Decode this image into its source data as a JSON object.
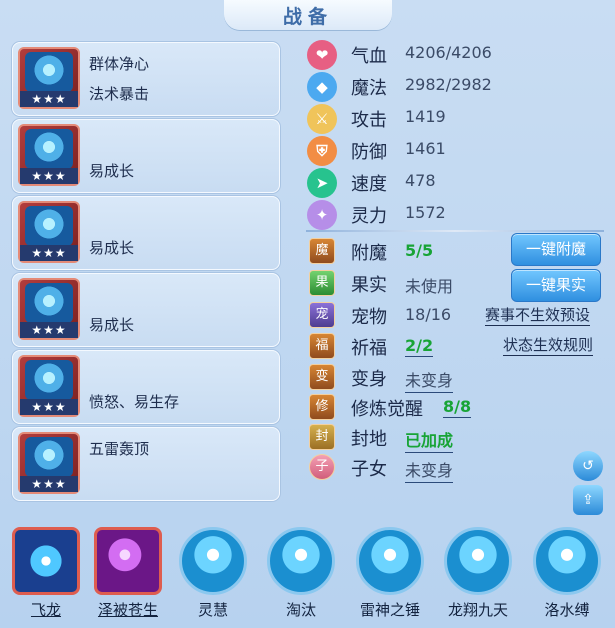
{
  "title": "战备",
  "equipment": [
    {
      "line1": "群体净心",
      "line2": "法术暴击",
      "stars": "★★★"
    },
    {
      "line1": "",
      "line2": "易成长",
      "stars": "★★★"
    },
    {
      "line1": "",
      "line2": "易成长",
      "stars": "★★★"
    },
    {
      "line1": "",
      "line2": "易成长",
      "stars": "★★★"
    },
    {
      "line1": "",
      "line2": "愤怒、易生存",
      "stars": "★★★"
    },
    {
      "line1": "五雷轰顶",
      "line2": "",
      "stars": "★★★"
    }
  ],
  "attributes": [
    {
      "label": "气血",
      "value": "4206/4206",
      "icon": "heart-icon",
      "color": "#e75f83"
    },
    {
      "label": "魔法",
      "value": "2982/2982",
      "icon": "diamond-icon",
      "color": "#4ca9f0"
    },
    {
      "label": "攻击",
      "value": "1419",
      "icon": "sword-icon",
      "color": "#f0c45a"
    },
    {
      "label": "防御",
      "value": "1461",
      "icon": "shield-icon",
      "color": "#f28d44"
    },
    {
      "label": "速度",
      "value": "478",
      "icon": "speed-icon",
      "color": "#27c38e"
    },
    {
      "label": "灵力",
      "value": "1572",
      "icon": "spirit-icon",
      "color": "#b68ee8"
    }
  ],
  "special": [
    {
      "label": "附魔",
      "value": "5/5",
      "style": "green",
      "icon": "enchant-icon"
    },
    {
      "label": "果实",
      "value": "未使用",
      "style": "normal",
      "icon": "fruit-icon"
    },
    {
      "label": "宠物",
      "value": "18/16",
      "style": "normal",
      "icon": "pet-icon"
    },
    {
      "label": "祈福",
      "value": "2/2",
      "style": "green",
      "icon": "blessing-icon"
    },
    {
      "label": "变身",
      "value": "未变身",
      "style": "underline",
      "icon": "transform-icon"
    },
    {
      "label": "修炼觉醒",
      "value": "8/8",
      "style": "green-underline",
      "icon": "cultivation-icon"
    },
    {
      "label": "封地",
      "value": "已加成",
      "style": "green-underline",
      "icon": "fief-icon"
    },
    {
      "label": "子女",
      "value": "未变身",
      "style": "underline",
      "icon": "children-icon"
    }
  ],
  "buttons": {
    "enchant": "一键附魔",
    "fruit": "一键果实"
  },
  "links": {
    "event_preset": "赛事不生效预设",
    "state_rules": "状态生效规则"
  },
  "bottom_skills": [
    {
      "label": "飞龙",
      "icon": "dragon-icon"
    },
    {
      "label": "泽被苍生",
      "icon": "blessing-hand-icon"
    },
    {
      "label": "灵慧",
      "icon": "wisdom-icon"
    },
    {
      "label": "淘汰",
      "icon": "eliminate-icon"
    },
    {
      "label": "雷神之锤",
      "icon": "hammer-icon"
    },
    {
      "label": "龙翔九天",
      "icon": "soaring-icon"
    },
    {
      "label": "洛水缚",
      "icon": "water-bind-icon"
    }
  ]
}
